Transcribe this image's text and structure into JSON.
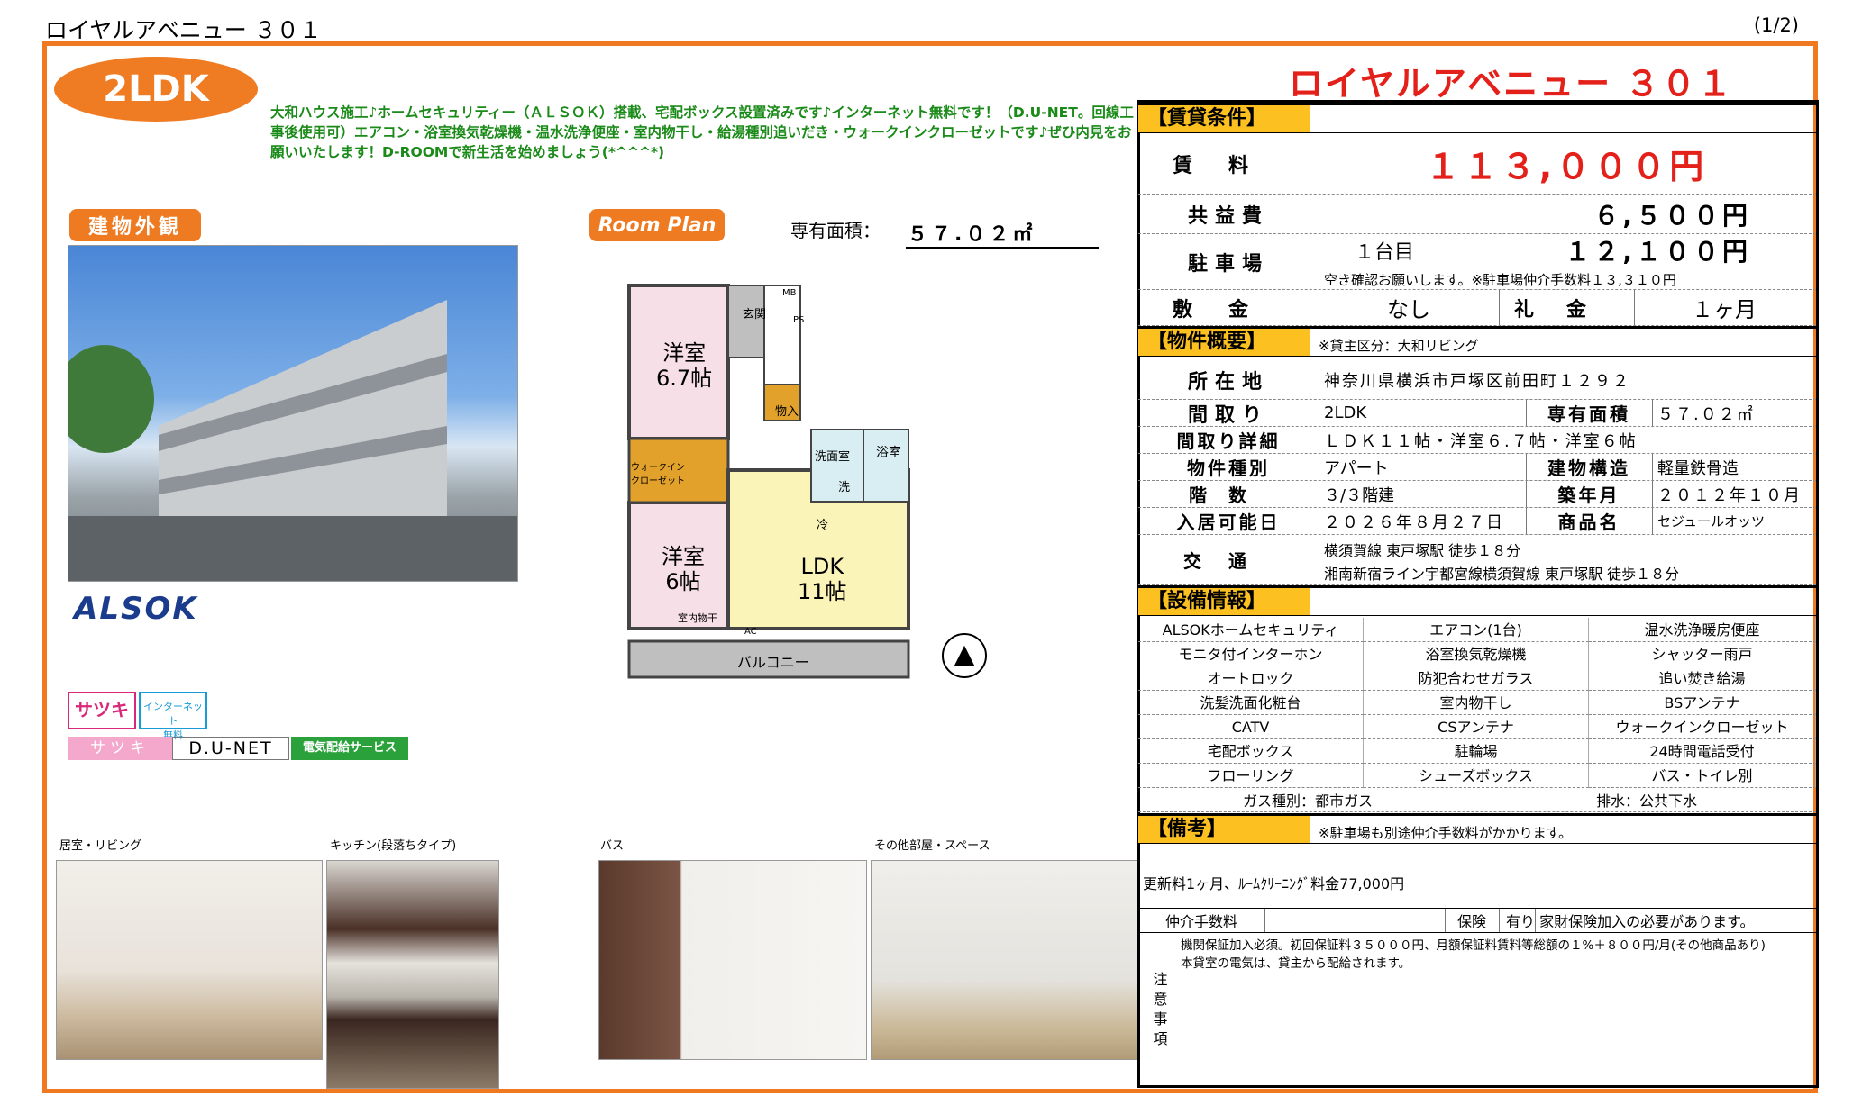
{
  "header": {
    "title": "ロイヤルアベニュー ３０１",
    "page": "(1/2)"
  },
  "room_type": "2LDK",
  "catch_copy": "大和ハウス施工♪ホームセキュリティー（ＡＬＳＯＫ）搭載、宅配ボックス設置済みです♪インターネット無料です！（D.U-NET。回線工事後使用可）エアコン・浴室換気乾燥機・温水洗浄便座・室内物干し・給湯種別追いだき・ウォークインクローゼットです♪ぜひ内見をお願いいたします！D-ROOMで新生活を始めましょう(*^^^*)",
  "exterior_tag": "建物外観",
  "room_plan_tag": "Room Plan",
  "area_label": "専有面積：",
  "area_value": "５７.０２㎡",
  "floorplan": {
    "room1": "洋室\n6.7帖",
    "room2": "洋室\n6帖",
    "ldk": "LDK\n11帖",
    "entrance": "玄関",
    "storage": "物入",
    "wash": "洗面室",
    "bath": "浴室",
    "closet": "ウォークイン\nクローゼット",
    "balcony": "バルコニー",
    "dryer": "室内物干",
    "mb": "MB",
    "ps": "PS",
    "sentaku": "洗",
    "rei": "冷",
    "ac": "AC"
  },
  "logos": {
    "alsok": "ALSOK",
    "satsuki": "サツキ",
    "internet": "インターネット\n無料",
    "satsuki2": "サツキ",
    "dunet": "D.U-NET",
    "denki": "電気配給サービス"
  },
  "photos": [
    {
      "caption": "居室・リビング"
    },
    {
      "caption": "キッチン(段落ちタイプ)"
    },
    {
      "caption": "バス"
    },
    {
      "caption": "その他部屋・スペース"
    }
  ],
  "property_name": "ロイヤルアベニュー ３０１",
  "rent": {
    "section": "【賃貸条件】",
    "rent_label": "賃料",
    "rent_value": "１１３,０００円",
    "common_label": "共益費",
    "common_value": "６,５００円",
    "parking_label": "駐車場",
    "parking_count": "１台目",
    "parking_value": "１２,１００円",
    "parking_note": "空き確認お願いします。※駐車場仲介手数料１３,３１０円",
    "deposit_label": "敷金",
    "deposit_value": "なし",
    "key_label": "礼金",
    "key_value": "１ヶ月"
  },
  "overview": {
    "section": "【物件概要】",
    "owner_note": "※貸主区分：大和リビング",
    "address_label": "所在地",
    "address": "神奈川県横浜市戸塚区前田町１２９２",
    "layout_label": "間取り",
    "layout": "2LDK",
    "area_label": "専有面積",
    "area": "５７.０２㎡",
    "detail_label": "間取り詳細",
    "detail": "ＬＤＫ１１帖・洋室６.７帖・洋室６帖",
    "kind_label": "物件種別",
    "kind": "アパート",
    "structure_label": "建物構造",
    "structure": "軽量鉄骨造",
    "floor_label": "階数",
    "floor": "３/３階建",
    "built_label": "築年月",
    "built": "２０１２年１０月",
    "movein_label": "入居可能日",
    "movein": "２０２６年８月２７日",
    "product_label": "商品名",
    "product": "セジュールオッツ",
    "traffic_label": "交通",
    "traffic1": "横須賀線 東戸塚駅 徒歩１８分",
    "traffic2": "湘南新宿ライン宇都宮線横須賀線 東戸塚駅 徒歩１８分"
  },
  "equipment": {
    "section": "【設備情報】",
    "items": [
      "ALSOKホームセキュリティ",
      "エアコン(1台)",
      "温水洗浄暖房便座",
      "モニタ付インターホン",
      "浴室換気乾燥機",
      "シャッター雨戸",
      "オートロック",
      "防犯合わせガラス",
      "追い焚き給湯",
      "洗髪洗面化粧台",
      "室内物干し",
      "BSアンテナ",
      "CATV",
      "CSアンテナ",
      "ウォークインクローゼット",
      "宅配ボックス",
      "駐輪場",
      "24時間電話受付",
      "フローリング",
      "シューズボックス",
      "バス・トイレ別"
    ],
    "gas": "ガス種別：都市ガス",
    "drain": "排水：公共下水"
  },
  "remarks": {
    "section": "【備考】",
    "note": "※駐車場も別途仲介手数料がかかります。",
    "renewal": "更新料1ヶ月、ﾙｰﾑｸﾘｰﾆﾝｸﾞ料金77,000円",
    "fee_label": "仲介手数料",
    "ins_label": "保険",
    "ins_value": "有り 家財保険加入の必要があります。",
    "caution_label": "注意事項",
    "caution": "機関保証加入必須。初回保証料３５０００円、月額保証料賃料等総額の１%＋８００円/月(その他商品あり)\n本貸室の電気は、貸主から配給されます。"
  },
  "colors": {
    "frame": "#f07820",
    "accent_red": "#e3211a",
    "section_yellow": "#fcc021",
    "catch_green": "#1a8a18"
  }
}
